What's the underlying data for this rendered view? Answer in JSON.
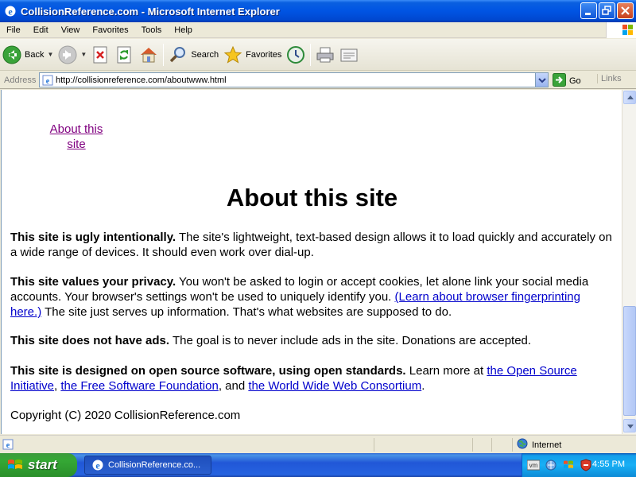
{
  "window": {
    "title": "CollisionReference.com - Microsoft Internet Explorer"
  },
  "menu": {
    "items": [
      "File",
      "Edit",
      "View",
      "Favorites",
      "Tools",
      "Help"
    ]
  },
  "toolbar": {
    "back_label": "Back",
    "search_label": "Search",
    "favorites_label": "Favorites"
  },
  "address": {
    "label": "Address",
    "url": "http://collisionreference.com/aboutwww.html",
    "go_label": "Go",
    "links_label": "Links"
  },
  "page": {
    "nav_link": "About this site",
    "heading": "About this site",
    "p1": {
      "bold": "This site is ugly intentionally.",
      "text": " The site's lightweight, text-based design allows it to load quickly and accurately on a wide range of devices. It should even work over dial-up."
    },
    "p2": {
      "bold": "This site values your privacy.",
      "text": " You won't be asked to login or accept cookies, let alone link your social media accounts. Your browser's settings won't be used to uniquely identify you. ",
      "link": "(Learn about browser fingerprinting here.)",
      "text2": " The site just serves up information. That's what websites are supposed to do."
    },
    "p3": {
      "bold": "This site does not have ads.",
      "text": " The goal is to never include ads in the site. Donations are accepted."
    },
    "p4": {
      "bold": "This site is designed on open source software, using open standards.",
      "text": " Learn more at ",
      "link1": "the Open Source Initiative",
      "sep1": ", ",
      "link2": "the Free Software Foundation",
      "sep2": ", and ",
      "link3": "the World Wide Web Consortium",
      "end": "."
    },
    "copyright": "Copyright (C) 2020 CollisionReference.com"
  },
  "status": {
    "zone": "Internet"
  },
  "taskbar": {
    "start_label": "start",
    "task_item": "CollisionReference.co...",
    "clock": "4:55 PM"
  },
  "colors": {
    "titlebar": "#0054e3",
    "link": "#0000cc",
    "visited_link": "#800080",
    "taskbar": "#2157d7",
    "start": "#35a835"
  }
}
